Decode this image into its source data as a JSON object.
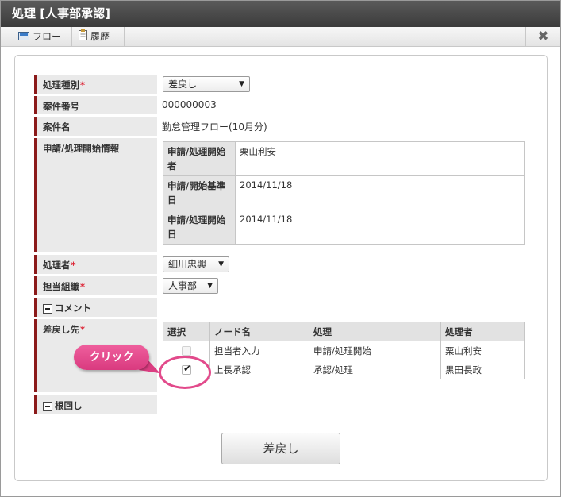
{
  "title": "処理 [人事部承認]",
  "toolbar": {
    "flow_label": "フロー",
    "history_label": "履歴"
  },
  "form": {
    "type_label": "処理種別",
    "type_value": "差戻し",
    "case_no_label": "案件番号",
    "case_no_value": "000000003",
    "case_name_label": "案件名",
    "case_name_value": "勤怠管理フロー(10月分)",
    "start_info_label": "申請/処理開始情報",
    "start_info": [
      {
        "key": "申請/処理開始者",
        "value": "栗山利安"
      },
      {
        "key": "申請/開始基準日",
        "value": "2014/11/18"
      },
      {
        "key": "申請/処理開始日",
        "value": "2014/11/18"
      }
    ],
    "processor_label": "処理者",
    "processor_value": "細川忠興",
    "org_label": "担当組織",
    "org_value": "人事部",
    "comment_label": "コメント",
    "return_label": "差戻し先",
    "return_headers": [
      "選択",
      "ノード名",
      "処理",
      "処理者"
    ],
    "return_rows": [
      {
        "checked": false,
        "disabled": true,
        "node": "担当者入力",
        "action": "申請/処理開始",
        "user": "栗山利安"
      },
      {
        "checked": true,
        "disabled": false,
        "node": "上長承認",
        "action": "承認/処理",
        "user": "黒田長政"
      }
    ],
    "circulation_label": "根回し",
    "required_mark": "*"
  },
  "submit_label": "差戻し",
  "callout_text": "クリック",
  "colors": {
    "accent_bar": "#8b1a1a",
    "callout": "#e24a8b",
    "title_bar": "#454545"
  }
}
